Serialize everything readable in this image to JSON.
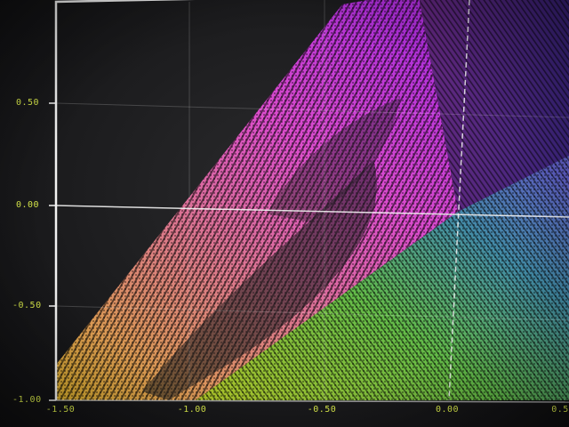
{
  "axes": {
    "y_ticks": [
      {
        "id": "y-050",
        "label": "0.50",
        "value": 0.5
      },
      {
        "id": "y-000",
        "label": "0.00",
        "value": 0.0
      },
      {
        "id": "y-m050",
        "label": "-0.50",
        "value": -0.5
      },
      {
        "id": "y-m100",
        "label": "-1.00",
        "value": -1.0
      }
    ],
    "x_ticks": [
      {
        "id": "x-m150",
        "label": "-1.50",
        "value": -1.5
      },
      {
        "id": "x-m100",
        "label": "-1.00",
        "value": -1.0
      },
      {
        "id": "x-m050",
        "label": "-0.50",
        "value": -0.5
      },
      {
        "id": "x-000",
        "label": "0.00",
        "value": 0.0
      },
      {
        "id": "x-050",
        "label": "0.5",
        "value": 0.5
      }
    ]
  },
  "colors": {
    "tick_label": "#d8e84a",
    "frame": "#f2f2f2",
    "background": "#1e1e20"
  }
}
